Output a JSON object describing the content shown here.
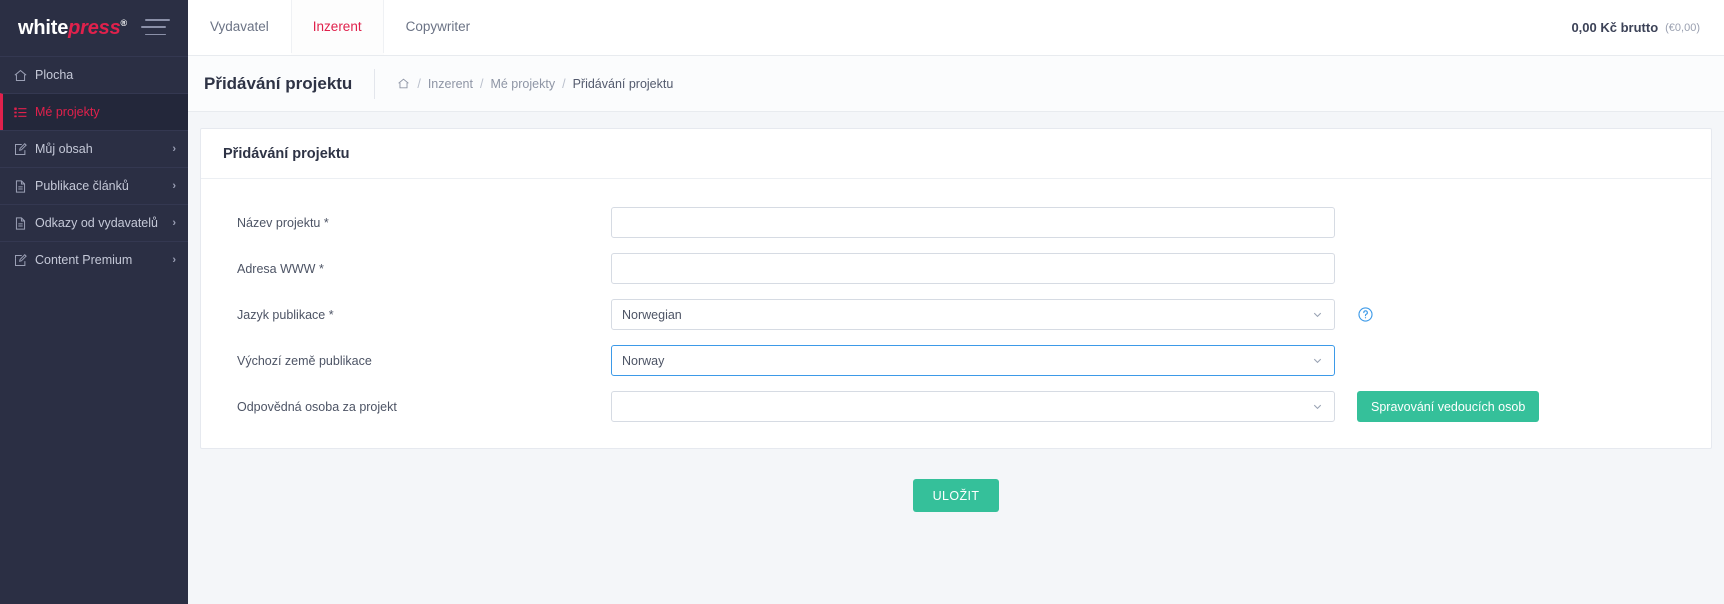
{
  "brand": {
    "part1": "white",
    "part2": "press",
    "trademark": "®",
    "menu_icon": "hamburger-icon"
  },
  "sidebar": {
    "items": [
      {
        "label": "Plocha",
        "icon": "home-icon",
        "active": false,
        "has_chevron": false,
        "chevron": ""
      },
      {
        "label": "Mé projekty",
        "icon": "list-icon",
        "active": true,
        "has_chevron": false,
        "chevron": ""
      },
      {
        "label": "Můj obsah",
        "icon": "pencil-square-icon",
        "active": false,
        "has_chevron": true,
        "chevron": "›"
      },
      {
        "label": "Publikace článků",
        "icon": "document-icon",
        "active": false,
        "has_chevron": true,
        "chevron": "›"
      },
      {
        "label": "Odkazy od vydavatelů",
        "icon": "document-icon",
        "active": false,
        "has_chevron": true,
        "chevron": "›"
      },
      {
        "label": "Content Premium",
        "icon": "pencil-square-icon",
        "active": false,
        "has_chevron": true,
        "chevron": "›"
      }
    ]
  },
  "topbar": {
    "tabs": [
      {
        "label": "Vydavatel",
        "active": false
      },
      {
        "label": "Inzerent",
        "active": true
      },
      {
        "label": "Copywriter",
        "active": false
      }
    ],
    "balance_main": "0,00 Kč brutto",
    "balance_secondary": "(€0,00)"
  },
  "pagehead": {
    "title": "Přidávání projektu",
    "breadcrumb": {
      "home_icon": "home-icon",
      "items": [
        "Inzerent",
        "Mé projekty",
        "Přidávání projektu"
      ],
      "separator": "/"
    }
  },
  "card": {
    "title": "Přidávání projektu",
    "fields": [
      {
        "label": "Název projektu *",
        "type": "text",
        "value": "",
        "placeholder": "",
        "focused": false,
        "after": "none"
      },
      {
        "label": "Adresa WWW *",
        "type": "text",
        "value": "",
        "placeholder": "",
        "focused": false,
        "after": "none"
      },
      {
        "label": "Jazyk publikace *",
        "type": "select",
        "value": "Norwegian",
        "placeholder": "",
        "focused": false,
        "after": "help"
      },
      {
        "label": "Výchozí země publikace",
        "type": "select",
        "value": "Norway",
        "placeholder": "",
        "focused": true,
        "after": "none"
      },
      {
        "label": "Odpovědná osoba za projekt",
        "type": "select",
        "value": "",
        "placeholder": "",
        "focused": false,
        "after": "button"
      }
    ],
    "manage_button_label": "Spravování vedoucích osob",
    "help_icon": "question-circle-icon"
  },
  "footer": {
    "save_label": "ULOŽIT"
  },
  "colors": {
    "accent_red": "#e0214c",
    "sidebar_bg": "#2b2f44",
    "green": "#35c09a",
    "focus_blue": "#3d9ae8"
  }
}
